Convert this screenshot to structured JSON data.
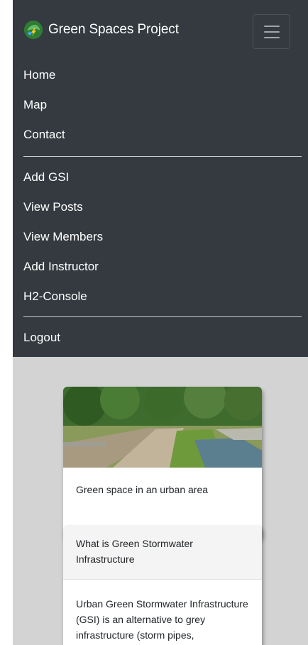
{
  "brand": {
    "name": "Green Spaces Project"
  },
  "navbar": {
    "toggle_icon": "hamburger-icon",
    "items": [
      "Home",
      "Map",
      "Contact"
    ],
    "admin_items": [
      "Add GSI",
      "View Posts",
      "View Members",
      "Add Instructor",
      "H2-Console"
    ],
    "logout": "Logout"
  },
  "image_card": {
    "caption": "Green space in an urban area"
  },
  "info_card": {
    "header": "What is Green Stormwater Infrastructure",
    "body": "Urban Green Stormwater Infrastructure (GSI) is an alternative to grey infrastructure (storm pipes,"
  },
  "colors": {
    "navbar": "#343a40",
    "page_bg": "#d3d3d3",
    "card_bg": "#ffffff"
  }
}
